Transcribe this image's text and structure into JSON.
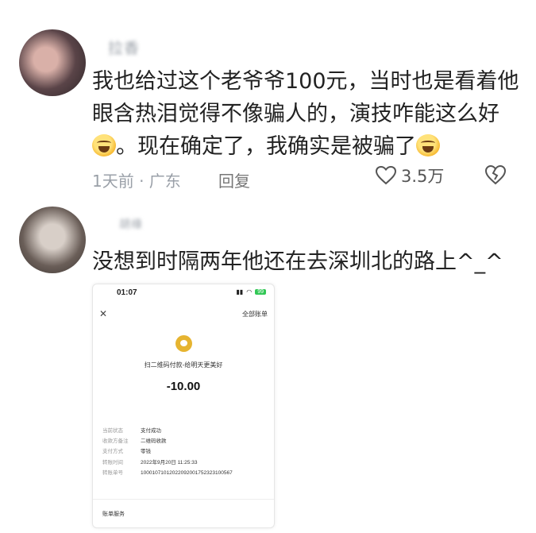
{
  "comment1": {
    "username": "拉香",
    "text_part1": "我也给过这个老爷爷100元，当时也是看着他眼含热泪觉得不像骗人的，演技咋能这么好",
    "text_part2": "。现在确定了，我确实是被骗了",
    "meta_time": "1天前 · 广东",
    "reply_label": "回复",
    "likes": "3.5万"
  },
  "comment2": {
    "username": "胡缘",
    "text": "没想到时隔两年他还在去深圳北的路上^_^"
  },
  "receipt": {
    "status_time": "01:07",
    "battery": "99",
    "all_bills": "全部账单",
    "title": "扫二维码付款-给明天更美好",
    "amount": "-10.00",
    "rows": [
      {
        "k": "当前状态",
        "v": "支付成功"
      },
      {
        "k": "收款方备注",
        "v": "二维码收款"
      },
      {
        "k": "支付方式",
        "v": "零钱"
      },
      {
        "k": "转账时间",
        "v": "2022年9月20日 11:25:33"
      },
      {
        "k": "转账单号",
        "v": "1000107101202209200175232310056​7"
      }
    ],
    "service": "账单服务"
  },
  "icons": {
    "emoji": "laughing-tears-emoji",
    "like": "heart-icon",
    "dislike": "broken-heart-icon",
    "close": "close-icon"
  }
}
